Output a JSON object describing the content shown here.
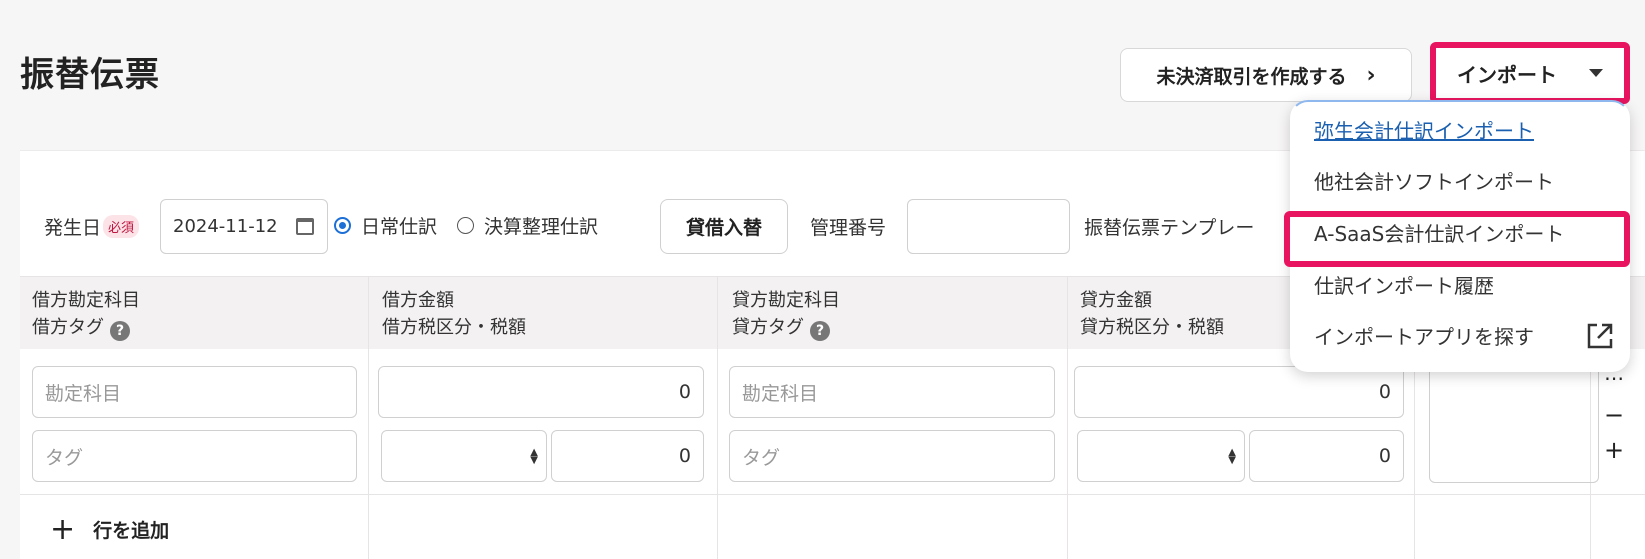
{
  "page": {
    "title": "振替伝票"
  },
  "header": {
    "unsettled_button": "未決済取引を作成する",
    "unsettled_chevron": "›",
    "import_button": "インポート"
  },
  "filters": {
    "date_label": "発生日",
    "required_badge": "必須",
    "date_value": "2024-11-12",
    "radio_normal": "日常仕訳",
    "radio_closing": "決算整理仕訳",
    "swap_button": "貸借入替",
    "mgmt_label": "管理番号",
    "template_label": "振替伝票テンプレー"
  },
  "table": {
    "headers": [
      {
        "line1": "借方勘定科目",
        "line2": "借方タグ"
      },
      {
        "line1": "借方金額",
        "line2": "借方税区分・税額"
      },
      {
        "line1": "貸方勘定科目",
        "line2": "貸方タグ"
      },
      {
        "line1": "貸方金額",
        "line2": "貸方税区分・税額"
      }
    ],
    "account_placeholder": "勘定科目",
    "tag_placeholder": "タグ",
    "debit_amount": "0",
    "debit_tax": "0",
    "credit_amount": "0",
    "credit_tax": "0",
    "add_row": "行を追加",
    "help_glyph": "?"
  },
  "import_menu": {
    "items": [
      "弥生会計仕訳インポート",
      "他社会計ソフトインポート",
      "A-SaaS会計仕訳インポート",
      "仕訳インポート履歴",
      "インポートアプリを探す"
    ]
  },
  "colors": {
    "highlight": "#e8145f",
    "link": "#1a5fb0",
    "radio": "#1b6fd6"
  }
}
